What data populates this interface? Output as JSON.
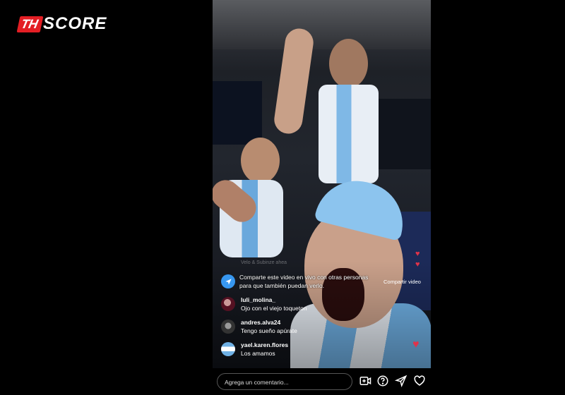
{
  "logo": {
    "prefix": "TH",
    "name": "SCORE"
  },
  "overlay": {
    "faint_text": "Velo & Subinze ahea"
  },
  "share_prompt": {
    "line1": "Comparte este video en vivo con otras personas",
    "line2": "para que también puedan verlo.",
    "button": "Compartir video"
  },
  "comments": [
    {
      "user": "luli_molina_",
      "text": "Ojo con el viejo toqueton"
    },
    {
      "user": "andres.alva24",
      "text": "Tengo sueño apúrate"
    },
    {
      "user": "yael.karen.flores",
      "text": "Los amamos"
    }
  ],
  "comment_box": {
    "placeholder": "Agrega un comentario..."
  },
  "icons": [
    "add-video-icon",
    "question-icon",
    "send-icon",
    "heart-icon"
  ],
  "colors": {
    "accent_blue": "#3797f0",
    "heart_red": "#e0334a",
    "logo_red": "#e31e24"
  }
}
